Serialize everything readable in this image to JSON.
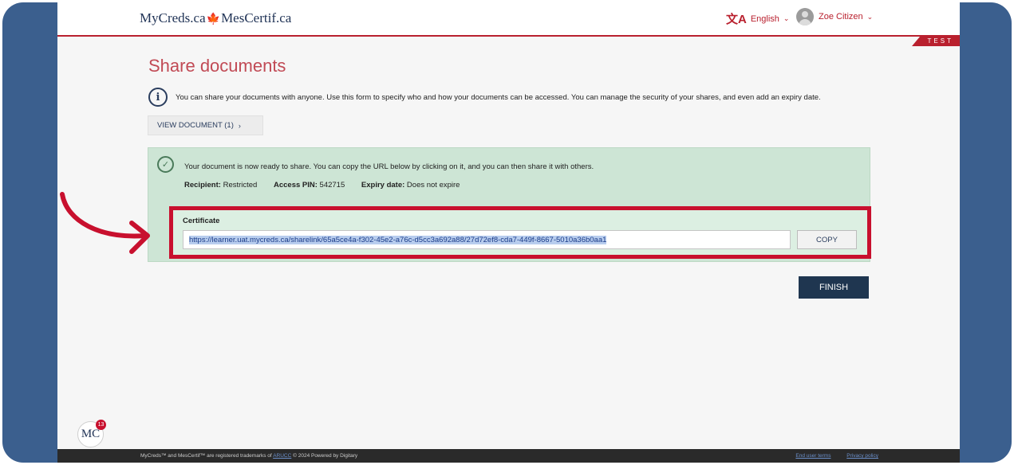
{
  "header": {
    "logo_left": "MyCreds.ca",
    "logo_leaf": "🍁",
    "logo_right": "MesCertif.ca",
    "language": "English",
    "user_name": "Zoe Citizen",
    "env_badge": "TEST"
  },
  "main": {
    "title": "Share documents",
    "info_text": "You can share your documents with anyone. Use this form to specify who and how your documents can be accessed. You can manage the security of your shares, and even add an expiry date.",
    "view_document_label": "VIEW DOCUMENT (1)",
    "success": {
      "message": "Your document is now ready to share. You can copy the URL below by clicking on it, and you can then share it with others.",
      "recipient_label": "Recipient:",
      "recipient_value": "Restricted",
      "pin_label": "Access PIN:",
      "pin_value": "542715",
      "expiry_label": "Expiry date:",
      "expiry_value": "Does not expire"
    },
    "certificate": {
      "label": "Certificate",
      "url": "https://learner.uat.mycreds.ca/sharelink/65a5ce4a-f302-45e2-a76c-d5cc3a692a88/27d72ef8-cda7-449f-8667-5010a36b0aa1",
      "copy_label": "COPY"
    },
    "finish_label": "FINISH"
  },
  "footer": {
    "text_before_link": "MyCreds™ and MesCertif™ are registered trademarks of",
    "link_text": "ARUCC",
    "text_after_link": "© 2024 Powered by Digitary",
    "end_user_terms": "End user terms",
    "privacy_policy": "Privacy policy"
  },
  "badge": {
    "initials": "MC",
    "count": "13"
  },
  "colors": {
    "frame": "#3b5f8e",
    "brand_red": "#c8102e",
    "navy": "#1f3650",
    "success_bg": "#cde5d5"
  },
  "icons": [
    "translate-icon",
    "chevron-down-icon",
    "avatar-icon",
    "info-icon",
    "chevron-right-icon",
    "check-circle-icon",
    "arrow-annotation-icon"
  ]
}
